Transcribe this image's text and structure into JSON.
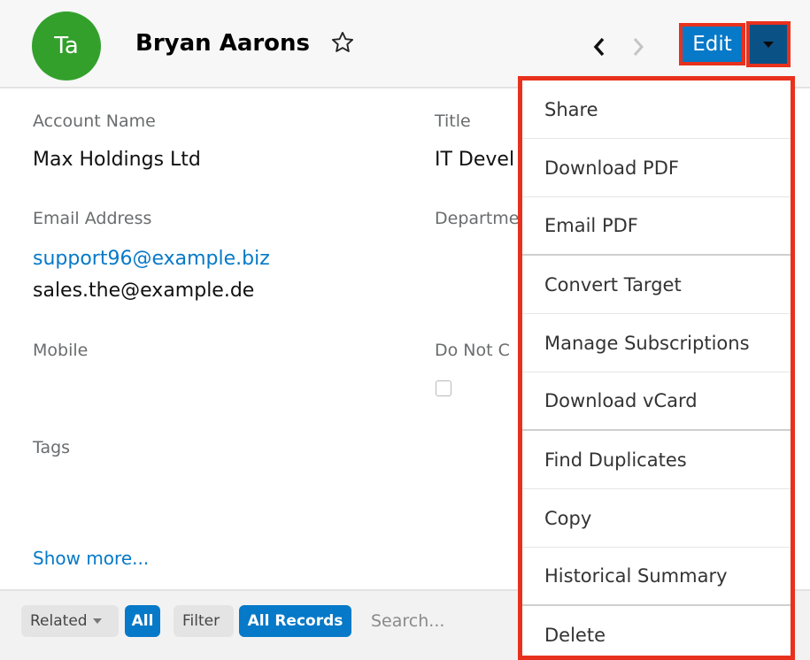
{
  "header": {
    "avatar_initials": "Ta",
    "record_name": "Bryan Aarons",
    "edit_label": "Edit"
  },
  "fields": {
    "account_name_label": "Account Name",
    "account_name_value": "Max Holdings Ltd",
    "title_label": "Title",
    "title_value": "IT Devel",
    "email_label": "Email Address",
    "email_primary": "support96@example.biz",
    "email_secondary": "sales.the@example.de",
    "department_label": "Departme",
    "mobile_label": "Mobile",
    "do_not_call_label": "Do Not C",
    "tags_label": "Tags",
    "show_more": "Show more..."
  },
  "actions_menu": {
    "items": [
      "Share",
      "Download PDF",
      "Email PDF",
      "Convert Target",
      "Manage Subscriptions",
      "Download vCard",
      "Find Duplicates",
      "Copy",
      "Historical Summary",
      "Delete"
    ]
  },
  "subpanel": {
    "related_label": "Related",
    "all_label": "All",
    "filter_label": "Filter",
    "all_records_label": "All Records",
    "search_placeholder": "Search..."
  },
  "colors": {
    "brand_blue": "#0679c8",
    "avatar_green": "#33a02c",
    "highlight_red": "#e8311d"
  }
}
